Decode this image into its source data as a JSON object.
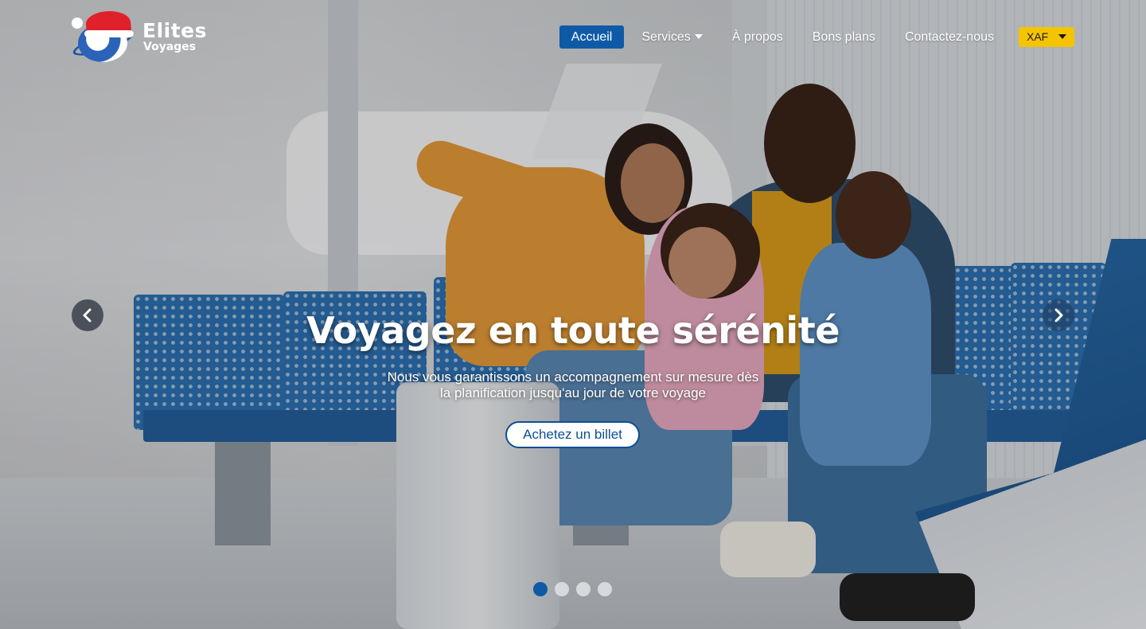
{
  "brand": {
    "name_line1": "Elites",
    "name_line2": "Voyages",
    "logo_icon": "santa-hat-globe-logo"
  },
  "nav": {
    "items": [
      {
        "label": "Accueil",
        "active": true
      },
      {
        "label": "Services",
        "has_dropdown": true
      },
      {
        "label": "À propos"
      },
      {
        "label": "Bons plans"
      },
      {
        "label": "Contactez-nous"
      }
    ],
    "currency": {
      "selected": "XAF",
      "color": "#f5c400"
    },
    "active_color": "#0e5aa6"
  },
  "hero": {
    "headline": "Voyagez en toute sérénité",
    "subtitle_line1": "Nous vous garantissons un accompagnement sur mesure dès",
    "subtitle_line2": "la planification jusqu'au jour de votre voyage",
    "cta_label": "Achetez un billet",
    "prev_icon": "chevron-left-icon",
    "next_icon": "chevron-right-icon"
  },
  "carousel": {
    "slide_count": 4,
    "active_index": 0
  }
}
